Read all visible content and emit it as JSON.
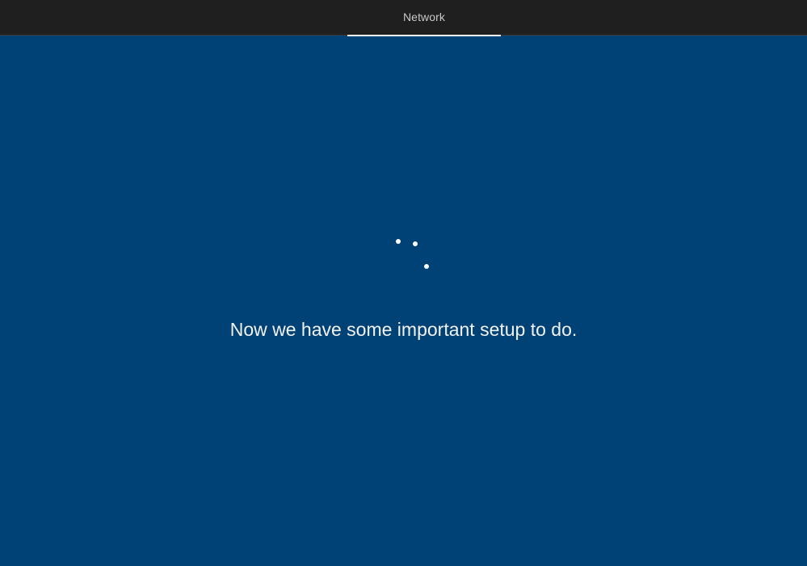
{
  "header": {
    "tabs": [
      {
        "label": "Network",
        "active": true
      }
    ]
  },
  "main": {
    "message": "Now we have some important setup to do.",
    "spinner": {
      "icon": "loading-dots-icon",
      "dot_count": 3
    }
  },
  "colors": {
    "background": "#004275",
    "header_background": "#1f1f1f",
    "text": "#f2f2f2",
    "tab_indicator": "#ffffff"
  }
}
